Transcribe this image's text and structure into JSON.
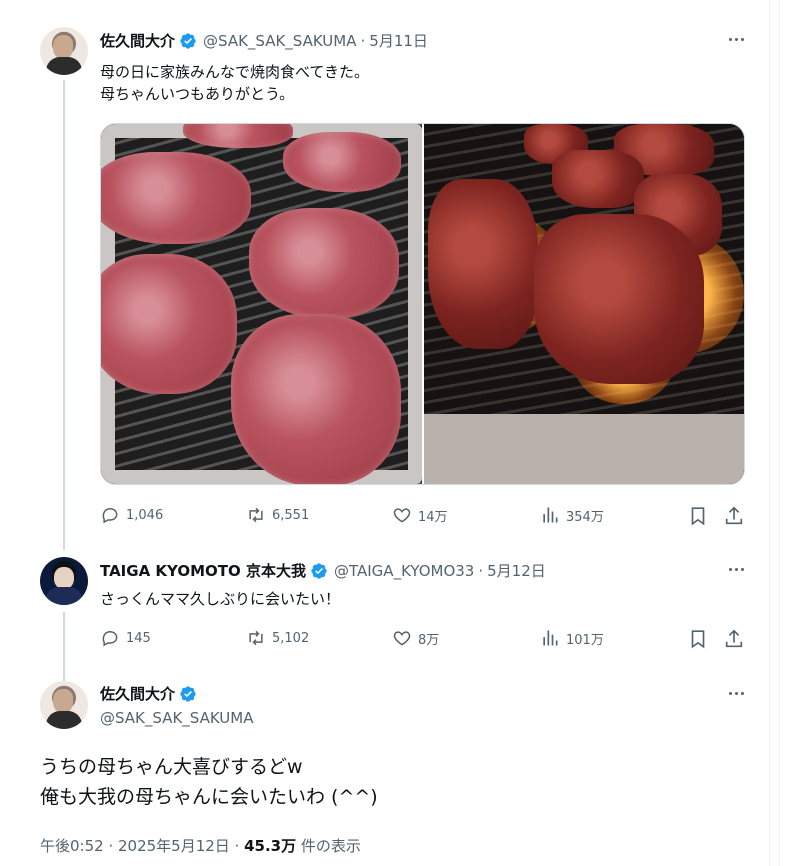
{
  "colors": {
    "accent": "#1d9bf0",
    "text_secondary": "#536471",
    "border": "#eff3f4"
  },
  "tweet1": {
    "author_name": "佐久間大介",
    "handle": "@SAK_SAK_SAKUMA",
    "separator": "·",
    "date": "5月11日",
    "text": "母の日に家族みんなで焼肉食べてきた。\n母ちゃんいつもありがとう。",
    "stats": {
      "replies": "1,046",
      "reposts": "6,551",
      "likes": "14万",
      "views": "354万"
    }
  },
  "tweet2": {
    "author_name": "TAIGA KYOMOTO 京本大我",
    "handle": "@TAIGA_KYOMO33",
    "separator": "·",
    "date": "5月12日",
    "text": "さっくんママ久しぶりに会いたい！",
    "stats": {
      "replies": "145",
      "reposts": "5,102",
      "likes": "8万",
      "views": "101万"
    }
  },
  "tweet3": {
    "author_name": "佐久間大介",
    "handle": "@SAK_SAK_SAKUMA",
    "text": "うちの母ちゃん大喜びするどw\n俺も大我の母ちゃんに会いたいわ (^^)",
    "timestamp": "午後0:52 · 2025年5月12日 · ",
    "views_count": "45.3万",
    "views_label": " 件の表示"
  },
  "icons": [
    "verified-badge-icon",
    "more-icon",
    "reply-icon",
    "repost-icon",
    "like-icon",
    "views-icon",
    "bookmark-icon",
    "share-icon"
  ]
}
